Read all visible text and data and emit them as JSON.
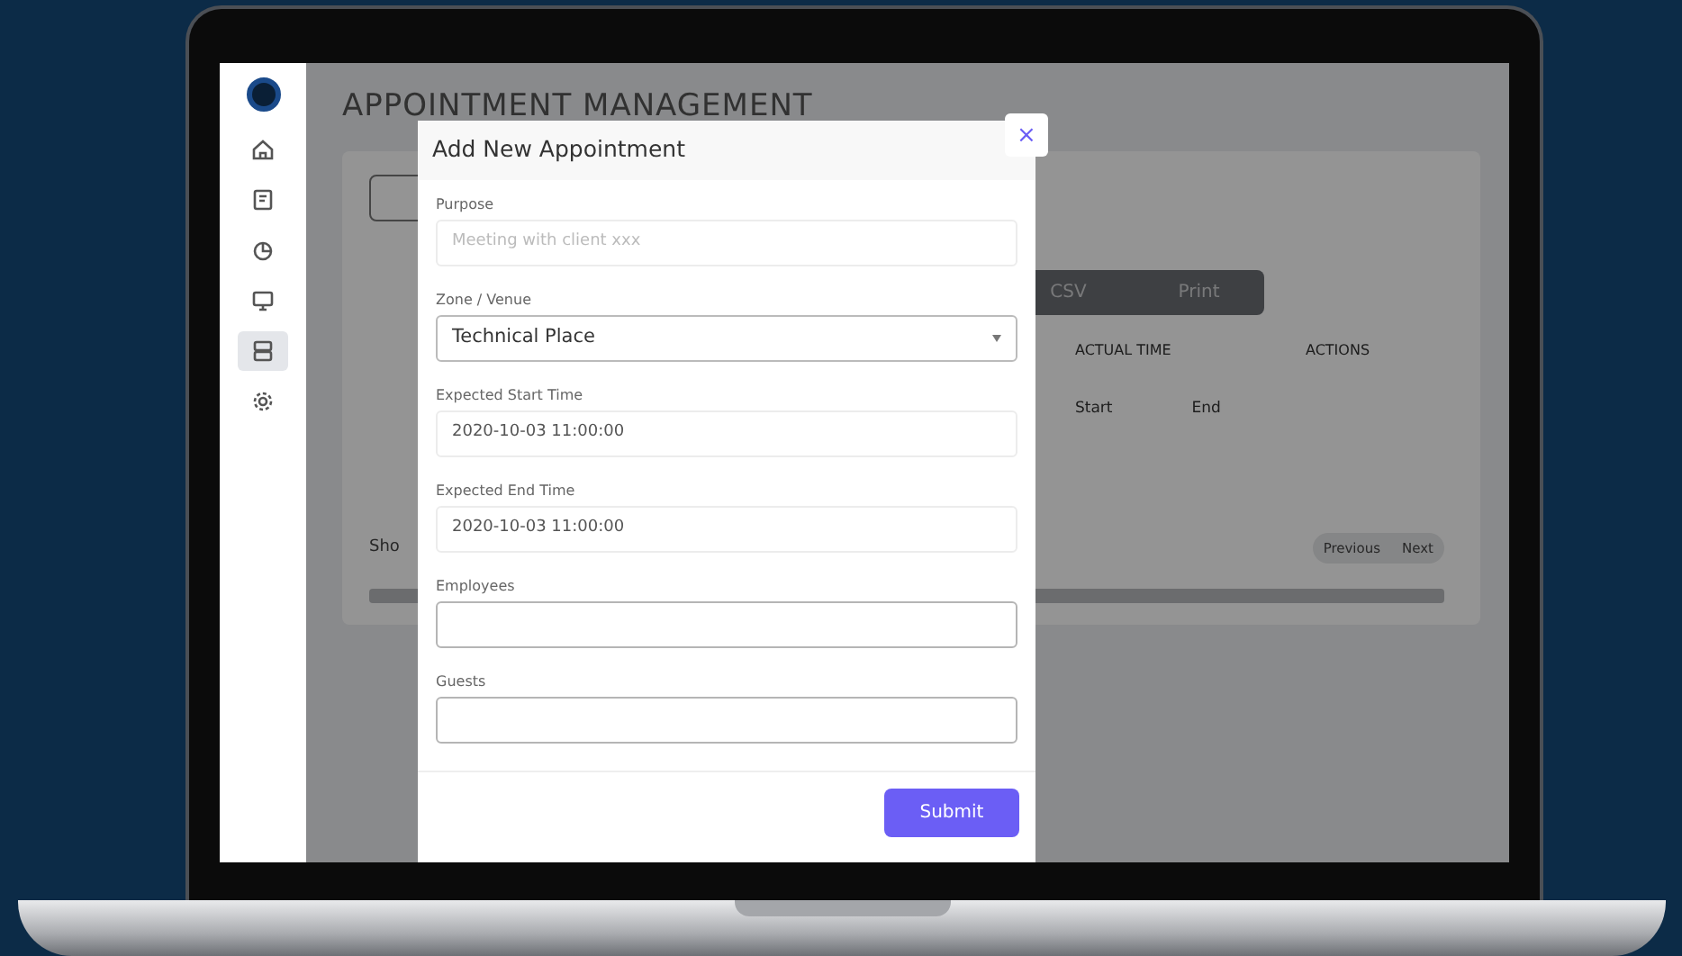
{
  "sidebar": {
    "items": [
      {
        "kind": "home",
        "selected": false
      },
      {
        "kind": "document",
        "selected": false
      },
      {
        "kind": "chart",
        "selected": false
      },
      {
        "kind": "monitor",
        "selected": false
      },
      {
        "kind": "server",
        "selected": true
      },
      {
        "kind": "gear",
        "selected": false
      }
    ]
  },
  "page": {
    "title": "APPOINTMENT MANAGEMENT",
    "export_buttons": [
      "CSV",
      "Print"
    ],
    "table": {
      "columns": [
        "ACTUAL TIME",
        "ACTIONS"
      ],
      "subcolumns": [
        "Start",
        "End"
      ]
    },
    "show_label": "Sho",
    "pagination": [
      "Previous",
      "Next"
    ]
  },
  "modal": {
    "title": "Add New Appointment",
    "close": "×",
    "fields": [
      {
        "label": "Purpose",
        "kind": "text",
        "placeholder": "Meeting with client xxx"
      },
      {
        "label": "Zone / Venue",
        "kind": "select",
        "value": "Technical Place"
      },
      {
        "label": "Expected Start Time",
        "kind": "text",
        "value": "2020-10-03 11:00:00"
      },
      {
        "label": "Expected End Time",
        "kind": "text",
        "value": "2020-10-03 11:00:00"
      },
      {
        "label": "Employees",
        "kind": "tags"
      },
      {
        "label": "Guests",
        "kind": "tags"
      }
    ],
    "submit": "Submit"
  }
}
